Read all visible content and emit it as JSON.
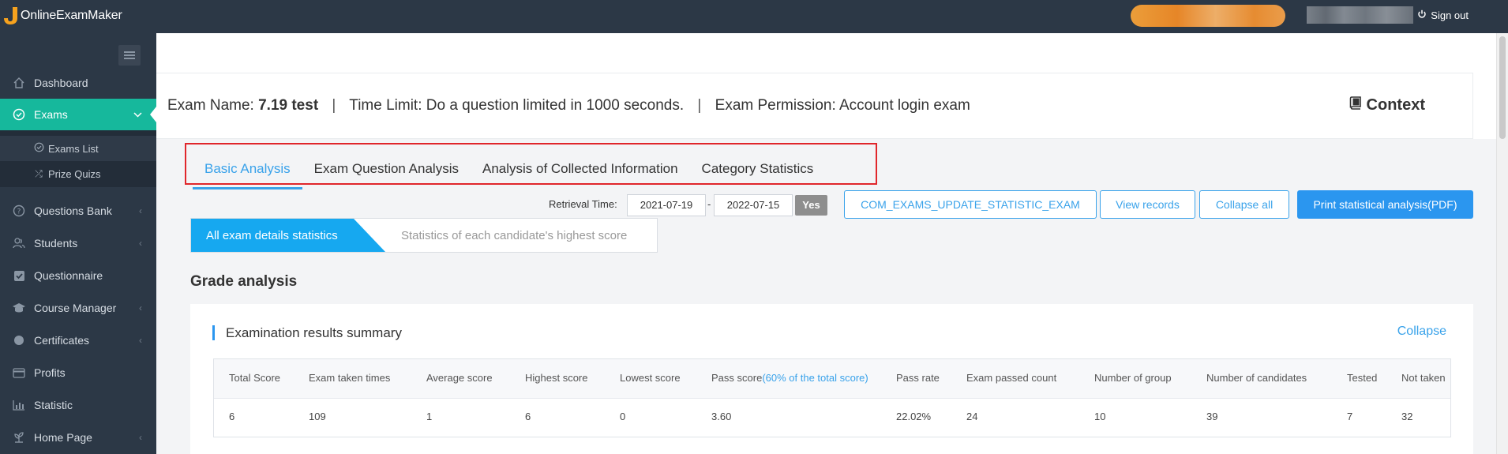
{
  "app": {
    "logo_text": "OnlineExamMaker",
    "signout": "Sign out"
  },
  "sidebar": {
    "items": [
      {
        "label": "Dashboard",
        "icon": "home-icon"
      },
      {
        "label": "Exams",
        "icon": "check-circle-icon",
        "active": true
      },
      {
        "label": "Questions Bank",
        "icon": "question-circle-icon"
      },
      {
        "label": "Students",
        "icon": "users-icon"
      },
      {
        "label": "Questionnaire",
        "icon": "checkbox-icon"
      },
      {
        "label": "Course Manager",
        "icon": "graduation-cap-icon"
      },
      {
        "label": "Certificates",
        "icon": "circle-icon"
      },
      {
        "label": "Profits",
        "icon": "card-icon"
      },
      {
        "label": "Statistic",
        "icon": "bar-chart-icon"
      },
      {
        "label": "Home Page",
        "icon": "plant-icon"
      }
    ],
    "sub_items": [
      {
        "label": "Exams List",
        "icon": "check-circle-icon"
      },
      {
        "label": "Prize Quizs",
        "icon": "shuffle-icon"
      }
    ]
  },
  "exam": {
    "name_label": "Exam Name:",
    "name_value": "7.19 test",
    "time_limit": "Time Limit: Do a question limited in 1000 seconds.",
    "permission": "Exam Permission: Account login exam",
    "context": "Context"
  },
  "tabs": [
    {
      "label": "Basic Analysis",
      "active": true
    },
    {
      "label": "Exam Question Analysis"
    },
    {
      "label": "Analysis of Collected Information"
    },
    {
      "label": "Category Statistics"
    }
  ],
  "toolbar": {
    "retrieval_label": "Retrieval Time:",
    "date_from": "2021-07-19",
    "date_to": "2022-07-15",
    "dash": "-",
    "yes_label": "Yes",
    "update_label": "COM_EXAMS_UPDATE_STATISTIC_EXAM",
    "view_records_label": "View records",
    "collapse_all_label": "Collapse all",
    "print_label": "Print statistical analysis(PDF)"
  },
  "subtabs": {
    "active": "All exam details statistics",
    "other": "Statistics of each candidate's highest score"
  },
  "grade": {
    "title": "Grade analysis",
    "card_title": "Examination results summary",
    "collapse": "Collapse",
    "headers": [
      "Total Score",
      "Exam taken times",
      "Average score",
      "Highest score",
      "Lowest score",
      "Pass score",
      "Pass rate",
      "Exam passed count",
      "Number of group",
      "Number of candidates",
      "Tested",
      "Not taken"
    ],
    "pass_hint": "(60% of the total score)",
    "values": [
      "6",
      "109",
      "1",
      "6",
      "0",
      "3.60",
      "22.02%",
      "24",
      "10",
      "39",
      "7",
      "32"
    ]
  },
  "colors": {
    "sidebar_bg": "#2c3846",
    "active_green": "#16b89c",
    "accent_blue": "#39a2ea",
    "highlight_red": "#e0262b"
  }
}
